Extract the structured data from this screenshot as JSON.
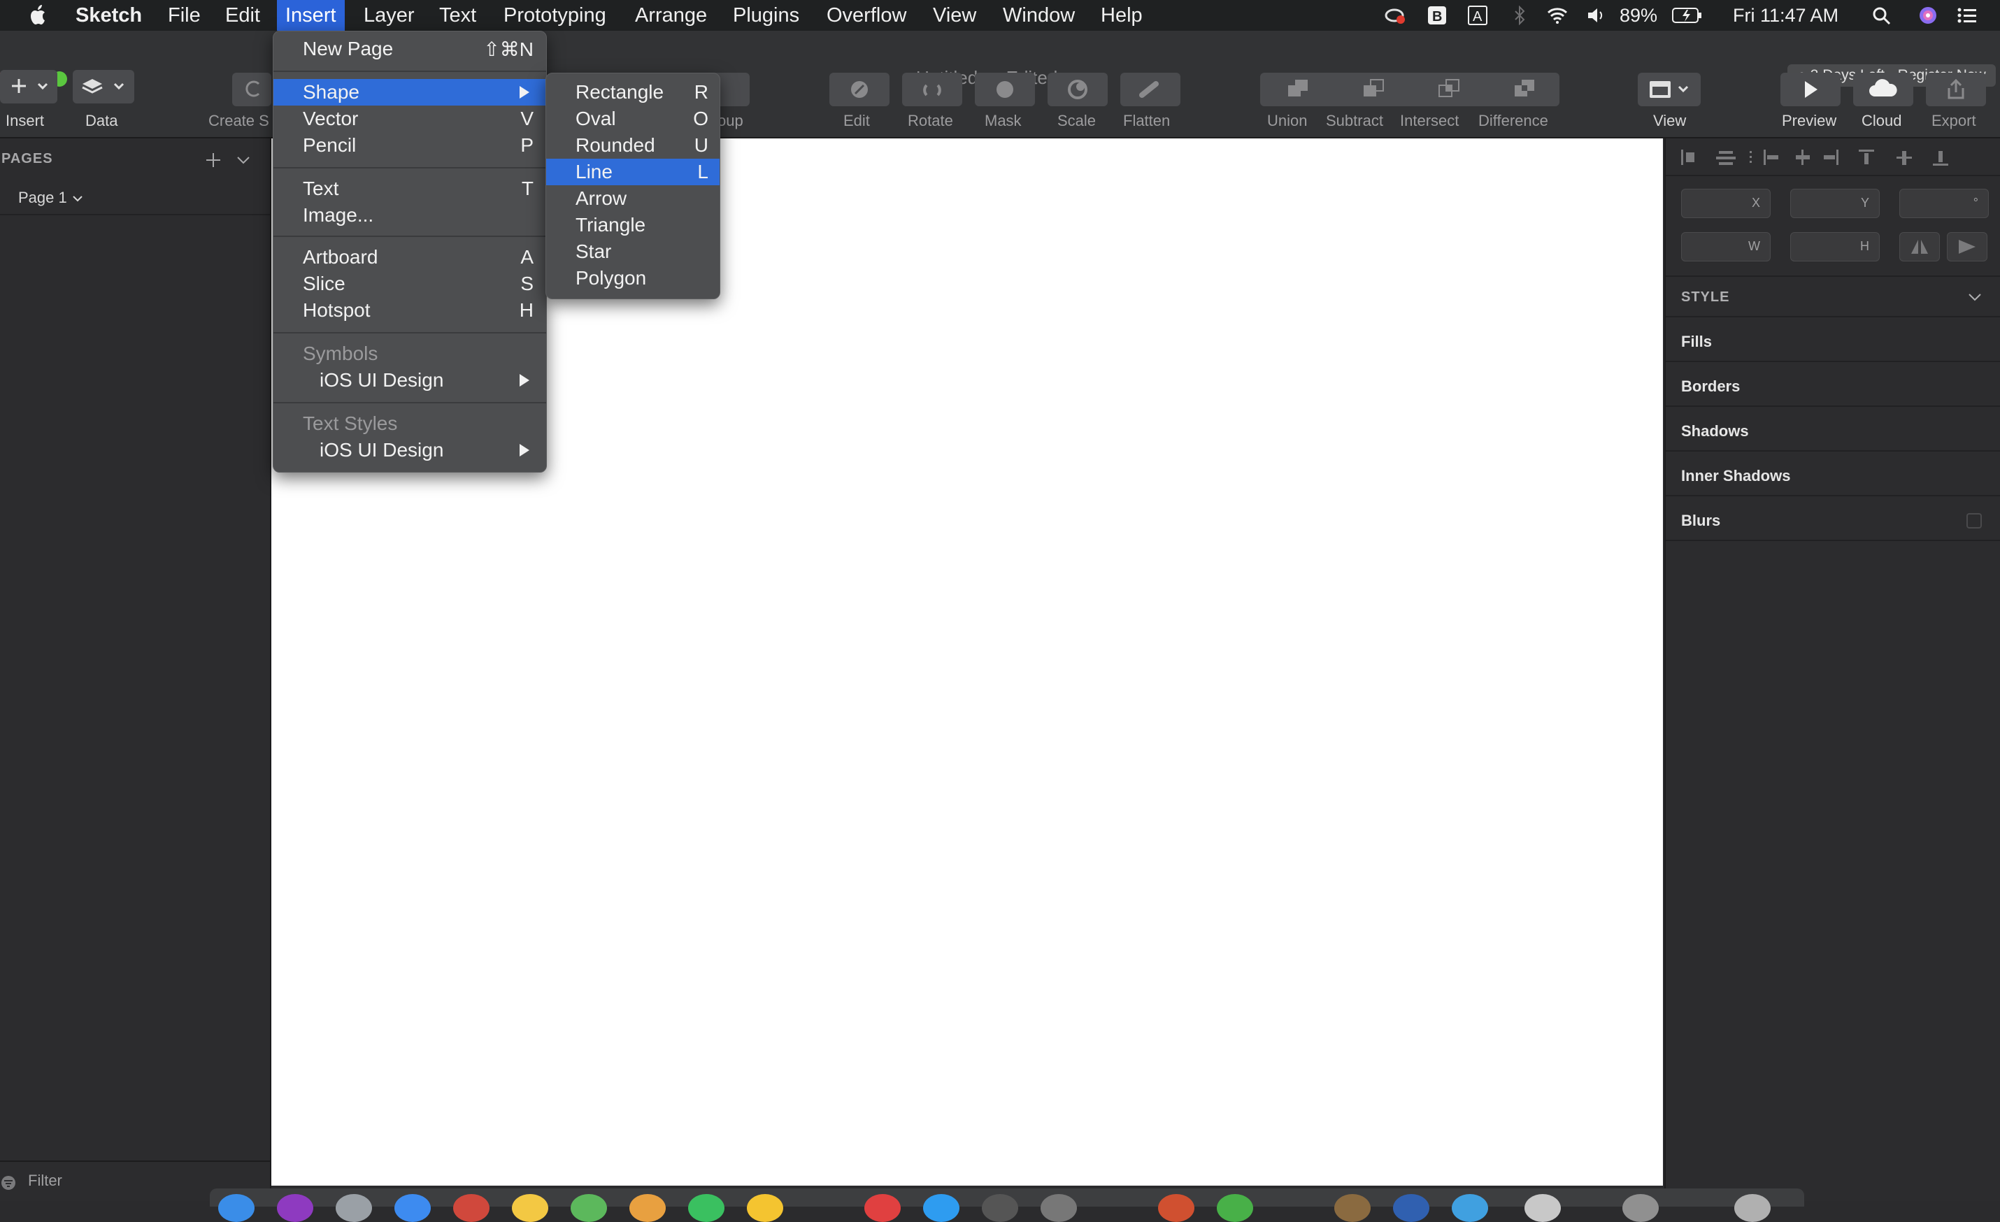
{
  "menubar": {
    "app_name": "Sketch",
    "menus": [
      "File",
      "Edit",
      "Insert",
      "Layer",
      "Text",
      "Prototyping",
      "Arrange",
      "Plugins",
      "Overflow",
      "View",
      "Window",
      "Help"
    ],
    "active_menu": "Insert",
    "battery": "89%",
    "clock": "Fri 11:47 AM"
  },
  "window": {
    "title": "Untitled",
    "title_suffix": " — Edited",
    "trial_badge": "● 3 Days Left - Register Now"
  },
  "toolbar": {
    "insert": "Insert",
    "data": "Data",
    "create_symbol": "Create S",
    "group_fragment": "oup",
    "edit": "Edit",
    "rotate": "Rotate",
    "mask": "Mask",
    "scale": "Scale",
    "flatten": "Flatten",
    "union": "Union",
    "subtract": "Subtract",
    "intersect": "Intersect",
    "difference": "Difference",
    "view": "View",
    "preview": "Preview",
    "cloud": "Cloud",
    "export": "Export"
  },
  "left_panel": {
    "pages_header": "PAGES",
    "page_name": "Page 1",
    "filter": "Filter"
  },
  "inspector": {
    "x_label": "X",
    "y_label": "Y",
    "rotation_label": "°",
    "w_label": "W",
    "h_label": "H",
    "style_header": "STYLE",
    "sections": [
      "Fills",
      "Borders",
      "Shadows",
      "Inner Shadows",
      "Blurs"
    ]
  },
  "insert_menu": {
    "items": [
      {
        "label": "New Page",
        "shortcut": "⇧⌘N"
      },
      {
        "label": "Shape",
        "shortcut": ""
      },
      {
        "label": "Vector",
        "shortcut": "V"
      },
      {
        "label": "Pencil",
        "shortcut": "P"
      },
      {
        "label": "Text",
        "shortcut": "T"
      },
      {
        "label": "Image...",
        "shortcut": ""
      },
      {
        "label": "Artboard",
        "shortcut": "A"
      },
      {
        "label": "Slice",
        "shortcut": "S"
      },
      {
        "label": "Hotspot",
        "shortcut": "H"
      },
      {
        "label": "Symbols",
        "shortcut": ""
      },
      {
        "label": "iOS UI Design",
        "shortcut": ""
      },
      {
        "label": "Text Styles",
        "shortcut": ""
      },
      {
        "label": "iOS UI Design",
        "shortcut": ""
      }
    ]
  },
  "shape_submenu": {
    "items": [
      {
        "label": "Rectangle",
        "shortcut": "R"
      },
      {
        "label": "Oval",
        "shortcut": "O"
      },
      {
        "label": "Rounded",
        "shortcut": "U"
      },
      {
        "label": "Line",
        "shortcut": "L"
      },
      {
        "label": "Arrow",
        "shortcut": ""
      },
      {
        "label": "Triangle",
        "shortcut": ""
      },
      {
        "label": "Star",
        "shortcut": ""
      },
      {
        "label": "Polygon",
        "shortcut": ""
      }
    ]
  },
  "colors": {
    "highlight": "#2f6cd8",
    "menubar_active": "#2b63d9",
    "canvas": "#ffffff"
  }
}
